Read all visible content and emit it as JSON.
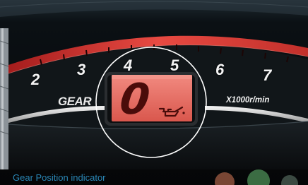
{
  "caption": "Gear Position indicator",
  "dial": {
    "numbers": [
      "2",
      "3",
      "4",
      "5",
      "6",
      "7"
    ],
    "gear_label": "GEAR",
    "rpm_unit": "X1000r/min"
  },
  "display": {
    "gear_value": "0"
  },
  "icons": {
    "oil_warning": "oil-can-icon",
    "magnifier_circle": "highlight-circle"
  },
  "colors": {
    "display_backlight": "#e9726a",
    "tach_redline": "#e23a35",
    "caption_text": "#2a86b5"
  }
}
